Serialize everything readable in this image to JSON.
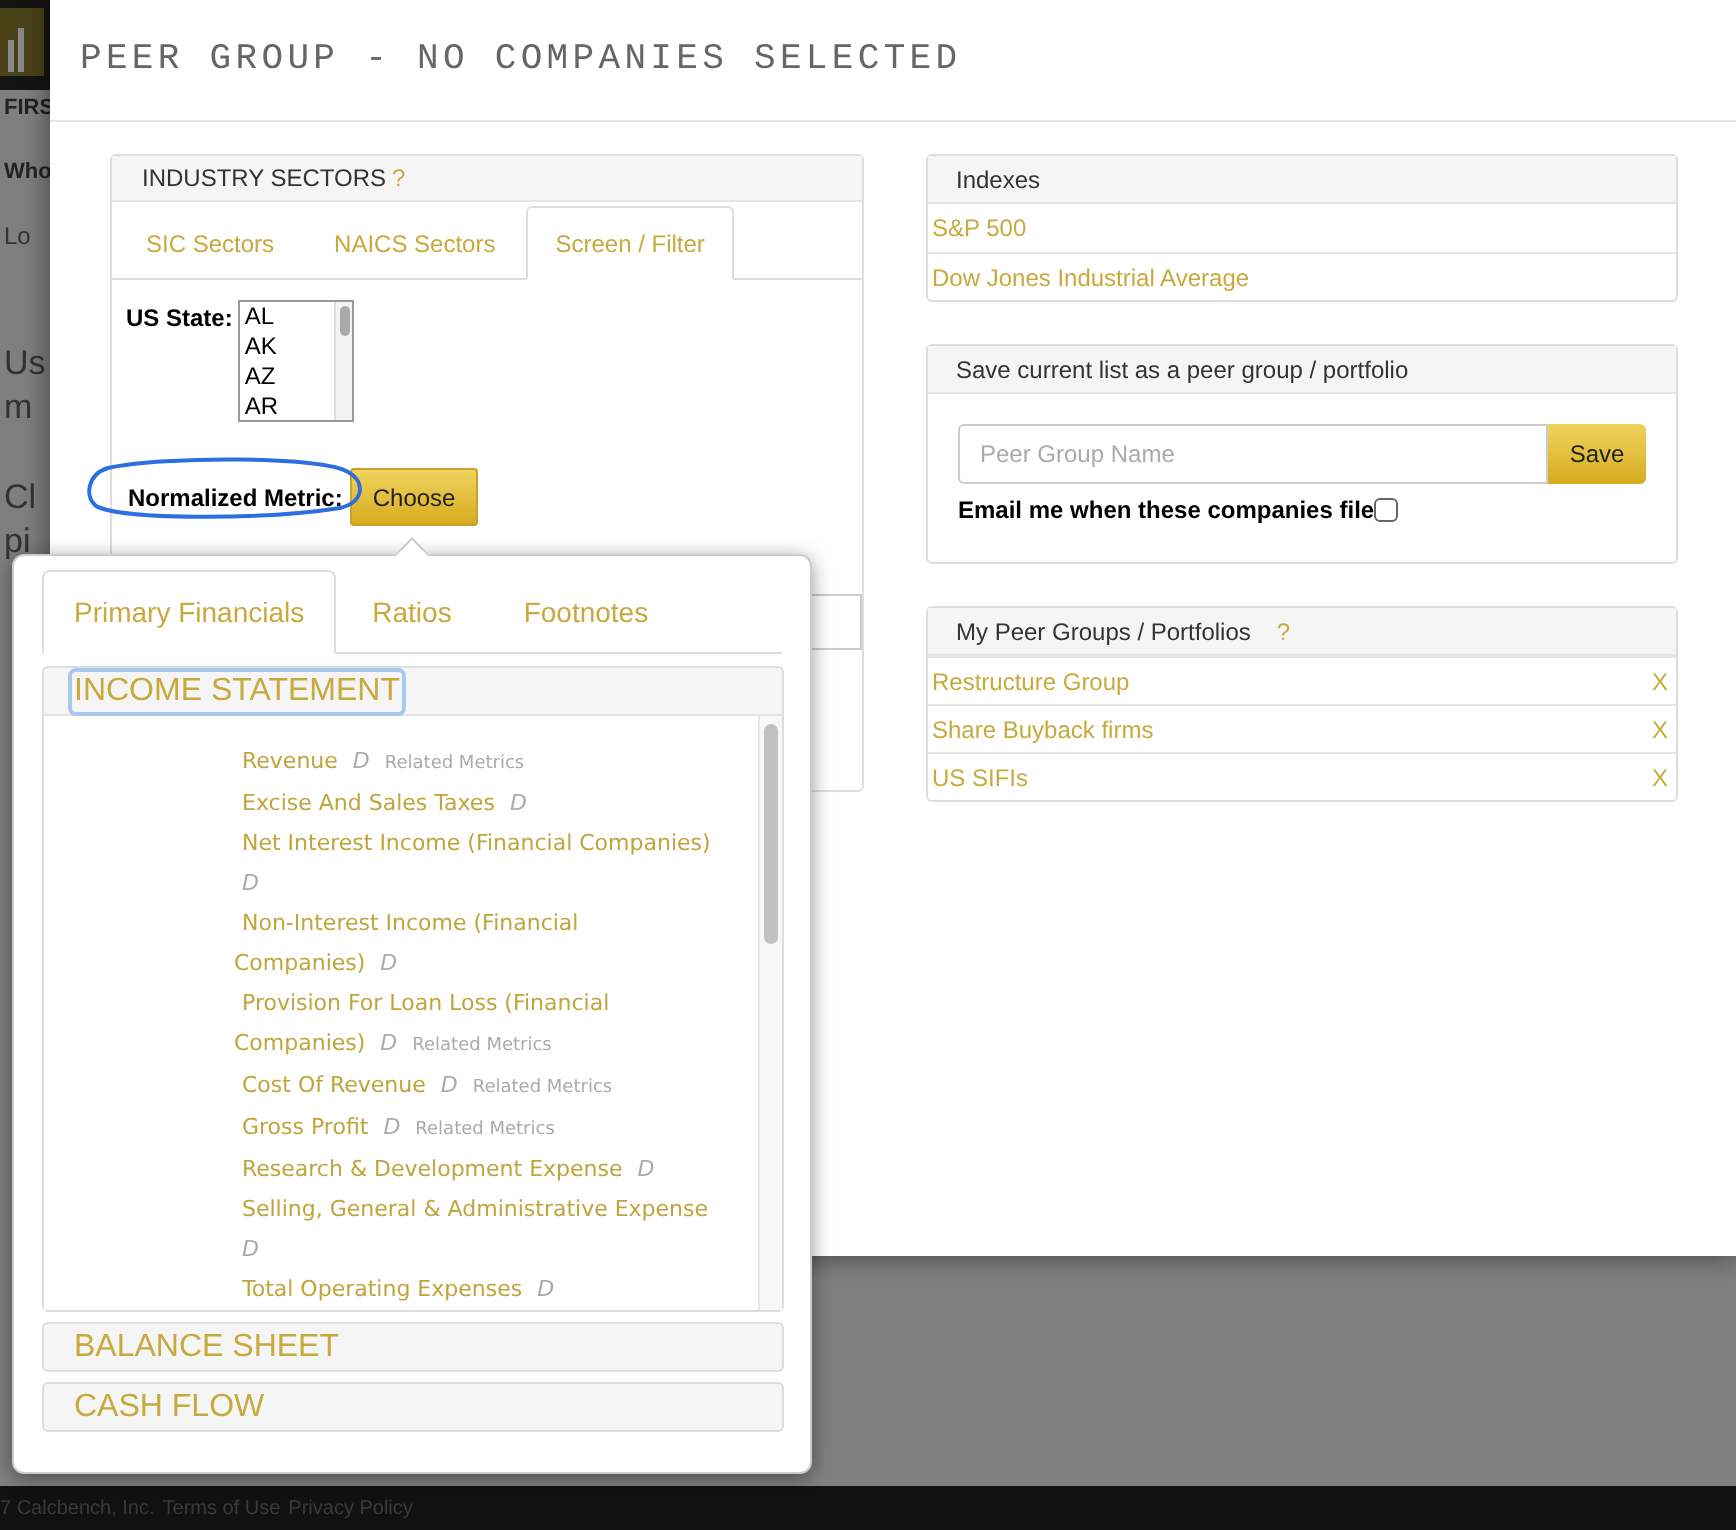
{
  "background_page": {
    "fragments": [
      {
        "kind": "heading",
        "lines": [
          "FIRS"
        ]
      },
      {
        "kind": "heading",
        "lines": [
          "Who"
        ]
      },
      {
        "kind": "small",
        "lines": [
          "Lo"
        ]
      },
      {
        "kind": "paragraph",
        "lines": [
          "Us",
          "m"
        ]
      },
      {
        "kind": "paragraph",
        "lines": [
          "Cl",
          "pi"
        ]
      }
    ],
    "footer": {
      "copyright": "7 Calcbench, Inc.",
      "links": [
        "Terms of Use",
        "Privacy Policy"
      ]
    }
  },
  "modal": {
    "title": "PEER GROUP - NO COMPANIES SELECTED",
    "industry_sectors": {
      "title": "INDUSTRY SECTORS",
      "help": "?",
      "tabs": [
        {
          "label": "SIC Sectors",
          "selected": false
        },
        {
          "label": "NAICS Sectors",
          "selected": false
        },
        {
          "label": "Screen / Filter",
          "selected": true
        }
      ],
      "us_state": {
        "label": "US State:",
        "options": [
          "AL",
          "AK",
          "AZ",
          "AR"
        ]
      },
      "normalized_metric": {
        "label": "Normalized Metric:",
        "button": "Choose"
      }
    },
    "indexes": {
      "title": "Indexes",
      "items": [
        "S&P 500",
        "Dow Jones Industrial Average"
      ]
    },
    "save_panel": {
      "title": "Save current list as a peer group / portfolio",
      "placeholder": "Peer Group Name",
      "button": "Save",
      "email_label": "Email me when these companies file",
      "email_checked": false
    },
    "my_peer_groups": {
      "title": "My Peer Groups / Portfolios",
      "help": "?",
      "items": [
        {
          "name": "Restructure Group",
          "remove": "X"
        },
        {
          "name": "Share Buyback firms",
          "remove": "X"
        },
        {
          "name": "US SIFIs",
          "remove": "X"
        }
      ]
    }
  },
  "metric_picker": {
    "tabs": [
      {
        "label": "Primary Financials",
        "selected": true
      },
      {
        "label": "Ratios",
        "selected": false
      },
      {
        "label": "Footnotes",
        "selected": false
      }
    ],
    "sections": [
      {
        "title": "INCOME STATEMENT",
        "focused": true,
        "items": [
          {
            "name": "Revenue",
            "mark": "D",
            "related": "Related Metrics"
          },
          {
            "name": "Excise And Sales Taxes",
            "mark": "D"
          },
          {
            "name": "Net Interest Income (Financial Companies)",
            "mark": "D"
          },
          {
            "name": "Non-Interest Income (Financial Companies)",
            "mark": "D"
          },
          {
            "name": "Provision For Loan Loss (Financial Companies)",
            "mark": "D",
            "related": "Related Metrics"
          },
          {
            "name": "Cost Of Revenue",
            "mark": "D",
            "related": "Related Metrics"
          },
          {
            "name": "Gross Profit",
            "mark": "D",
            "related": "Related Metrics"
          },
          {
            "name": "Research & Development Expense",
            "mark": "D"
          },
          {
            "name": "Selling, General & Administrative Expense",
            "mark": "D"
          },
          {
            "name": "Total Operating Expenses",
            "mark": "D"
          }
        ]
      },
      {
        "title": "BALANCE SHEET",
        "focused": false
      },
      {
        "title": "CASH FLOW",
        "focused": false
      }
    ]
  }
}
